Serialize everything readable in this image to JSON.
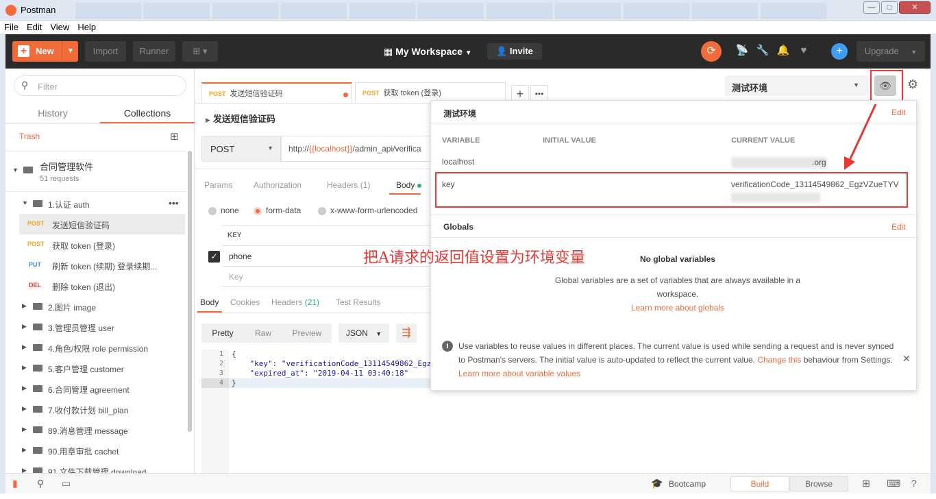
{
  "window": {
    "title": "Postman",
    "min": "—",
    "max": "□",
    "close": "✕"
  },
  "menu": [
    "File",
    "Edit",
    "View",
    "Help"
  ],
  "toolbar": {
    "new_label": "New",
    "import_label": "Import",
    "runner_label": "Runner",
    "workspace_label": "My Workspace",
    "invite_label": "Invite",
    "upgrade_label": "Upgrade"
  },
  "sidebar": {
    "filter_placeholder": "Filter",
    "tabs": [
      "History",
      "Collections"
    ],
    "trash_label": "Trash",
    "collection": {
      "name": "合同管理软件",
      "count": "51 requests"
    },
    "items": [
      {
        "type": "folder",
        "label": "1.认证 auth",
        "open": true
      },
      {
        "type": "request",
        "method": "POST",
        "label": "发送短信验证码",
        "selected": true
      },
      {
        "type": "request",
        "method": "POST",
        "label": "获取 token (登录)"
      },
      {
        "type": "request",
        "method": "PUT",
        "label": "刷新 token (续期) 登录续期..."
      },
      {
        "type": "request",
        "method": "DEL",
        "label": "删除 token (退出)"
      },
      {
        "type": "folder",
        "label": "2.图片 image"
      },
      {
        "type": "folder",
        "label": "3.管理员管理 user"
      },
      {
        "type": "folder",
        "label": "4.角色/权限 role permission"
      },
      {
        "type": "folder",
        "label": "5.客户管理 customer"
      },
      {
        "type": "folder",
        "label": "6.合同管理 agreement"
      },
      {
        "type": "folder",
        "label": "7.收付款计划 bill_plan"
      },
      {
        "type": "folder",
        "label": "89.消息管理 message"
      },
      {
        "type": "folder",
        "label": "90.用章审批 cachet"
      },
      {
        "type": "folder",
        "label": "91.文件下载管理 download"
      }
    ]
  },
  "request_tabs": [
    {
      "method": "POST",
      "label": "发送短信验证码"
    },
    {
      "method": "POST",
      "label": "获取 token (登录)"
    }
  ],
  "request": {
    "name": "发送短信验证码",
    "method": "POST",
    "url_prefix": "http://",
    "url_var": "{{localhost}}",
    "url_suffix": "/admin_api/verifica",
    "subtabs": [
      "Params",
      "Authorization",
      "Headers (1)",
      "Body"
    ],
    "body_modes": [
      "none",
      "form-data",
      "x-www-form-urlencoded"
    ],
    "kv_header": "KEY",
    "kv_rows": [
      "phone"
    ],
    "kv_placeholder": "Key"
  },
  "response": {
    "tabs": [
      "Body",
      "Cookies",
      "Headers (21)",
      "Test Results"
    ],
    "view_modes": [
      "Pretty",
      "Raw",
      "Preview"
    ],
    "format": "JSON",
    "line_numbers": [
      "1",
      "2",
      "3",
      "4"
    ],
    "code": [
      "{",
      "    \"key\": \"verificationCode_13114549862_Egz",
      "    \"expired_at\": \"2019-04-11 03:40:18\"",
      "}"
    ]
  },
  "env": {
    "selected": "测试环境",
    "popup_title": "测试环境",
    "edit_label": "Edit",
    "col_variable": "VARIABLE",
    "col_initial": "INITIAL VALUE",
    "col_current": "CURRENT VALUE",
    "vars": [
      {
        "name": "localhost",
        "current": ".org"
      },
      {
        "name": "key",
        "current": "verificationCode_13114549862_EgzVZueTYV"
      }
    ],
    "globals_title": "Globals",
    "no_globals": "No global variables",
    "globals_desc": "Global variables are a set of variables that are always available in a workspace.",
    "learn_globals": "Learn more about globals",
    "info_1": "Use variables to reuse values in different places. The current value is used while sending a request and is never synced to Postman's servers. The initial value is auto-updated to reflect the current value.",
    "info_link1": "Change this",
    "info_2": "behaviour from Settings.",
    "info_link2": "Learn more about variable values"
  },
  "annotation": "把A请求的返回值设置为环境变量",
  "bottombar": {
    "bootcamp": "Bootcamp",
    "build": "Build",
    "browse": "Browse"
  },
  "colors": {
    "accent": "#f26b3a",
    "annotation": "#e53935",
    "post": "#f4a31f",
    "put": "#3f8ee8",
    "del": "#e53935"
  }
}
